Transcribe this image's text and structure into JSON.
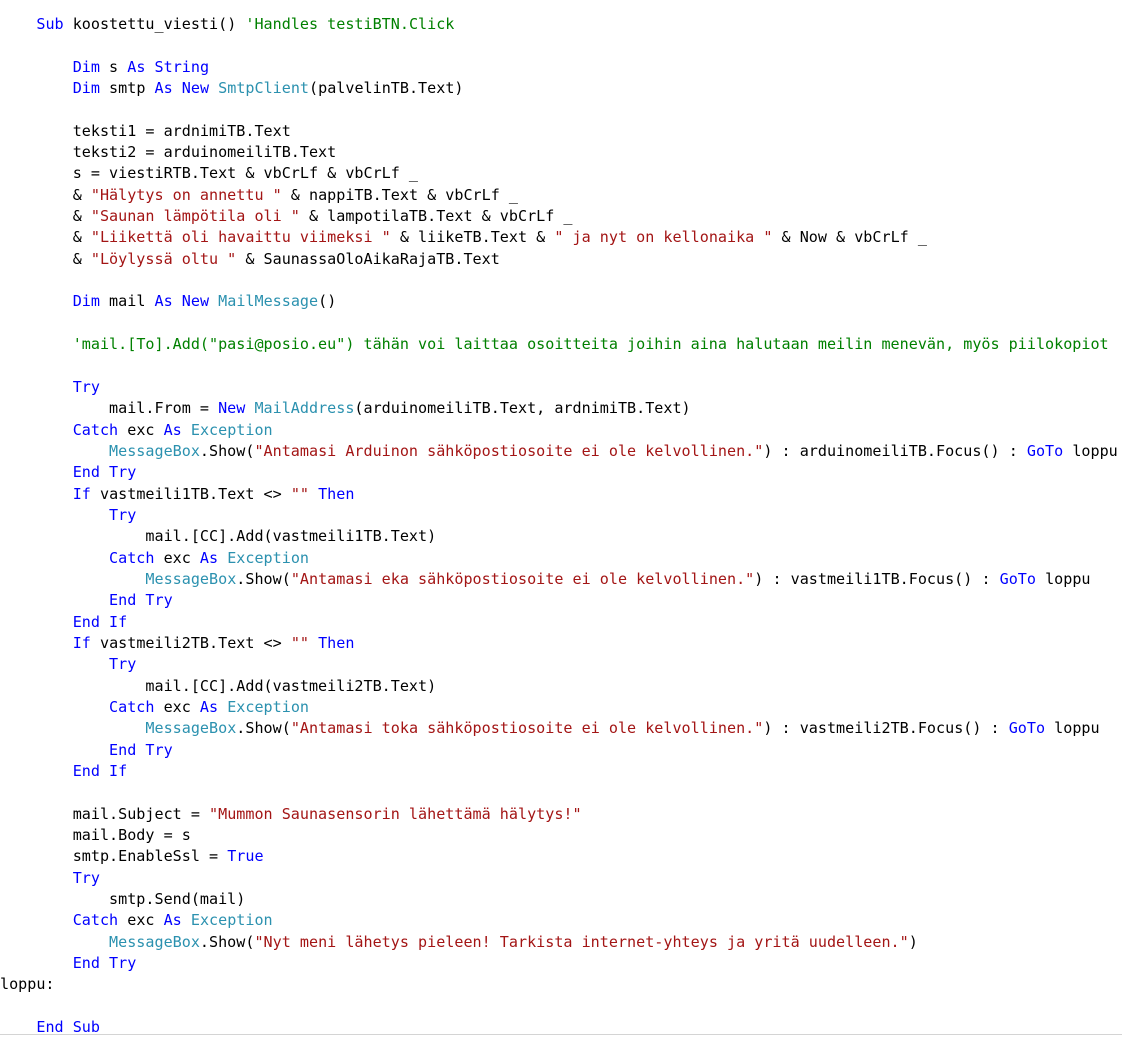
{
  "code": {
    "colors": {
      "keyword": "#0000ff",
      "type": "#2b91af",
      "string": "#a31515",
      "comment": "#008000",
      "plain": "#000000"
    },
    "lines": [
      [
        {
          "t": "    ",
          "c": "pl"
        },
        {
          "t": "Sub",
          "c": "kw"
        },
        {
          "t": " koostettu_viesti() ",
          "c": "pl"
        },
        {
          "t": "'Handles testiBTN.Click",
          "c": "cm"
        }
      ],
      [],
      [
        {
          "t": "        ",
          "c": "pl"
        },
        {
          "t": "Dim",
          "c": "kw"
        },
        {
          "t": " s ",
          "c": "pl"
        },
        {
          "t": "As",
          "c": "kw"
        },
        {
          "t": " ",
          "c": "pl"
        },
        {
          "t": "String",
          "c": "kw"
        }
      ],
      [
        {
          "t": "        ",
          "c": "pl"
        },
        {
          "t": "Dim",
          "c": "kw"
        },
        {
          "t": " smtp ",
          "c": "pl"
        },
        {
          "t": "As",
          "c": "kw"
        },
        {
          "t": " ",
          "c": "pl"
        },
        {
          "t": "New",
          "c": "kw"
        },
        {
          "t": " ",
          "c": "pl"
        },
        {
          "t": "SmtpClient",
          "c": "ty"
        },
        {
          "t": "(palvelinTB.Text)",
          "c": "pl"
        }
      ],
      [],
      [
        {
          "t": "        teksti1 = ardnimiTB.Text",
          "c": "pl"
        }
      ],
      [
        {
          "t": "        teksti2 = arduinomeiliTB.Text",
          "c": "pl"
        }
      ],
      [
        {
          "t": "        s = viestiRTB.Text & vbCrLf & vbCrLf _",
          "c": "pl"
        }
      ],
      [
        {
          "t": "        & ",
          "c": "pl"
        },
        {
          "t": "\"Hälytys on annettu \"",
          "c": "st"
        },
        {
          "t": " & nappiTB.Text & vbCrLf _",
          "c": "pl"
        }
      ],
      [
        {
          "t": "        & ",
          "c": "pl"
        },
        {
          "t": "\"Saunan lämpötila oli \"",
          "c": "st"
        },
        {
          "t": " & lampotilaTB.Text & vbCrLf _",
          "c": "pl"
        }
      ],
      [
        {
          "t": "        & ",
          "c": "pl"
        },
        {
          "t": "\"Liikettä oli havaittu viimeksi \"",
          "c": "st"
        },
        {
          "t": " & liikeTB.Text & ",
          "c": "pl"
        },
        {
          "t": "\" ja nyt on kellonaika \"",
          "c": "st"
        },
        {
          "t": " & Now & vbCrLf _",
          "c": "pl"
        }
      ],
      [
        {
          "t": "        & ",
          "c": "pl"
        },
        {
          "t": "\"Löylyssä oltu \"",
          "c": "st"
        },
        {
          "t": " & SaunassaOloAikaRajaTB.Text",
          "c": "pl"
        }
      ],
      [],
      [
        {
          "t": "        ",
          "c": "pl"
        },
        {
          "t": "Dim",
          "c": "kw"
        },
        {
          "t": " mail ",
          "c": "pl"
        },
        {
          "t": "As",
          "c": "kw"
        },
        {
          "t": " ",
          "c": "pl"
        },
        {
          "t": "New",
          "c": "kw"
        },
        {
          "t": " ",
          "c": "pl"
        },
        {
          "t": "MailMessage",
          "c": "ty"
        },
        {
          "t": "()",
          "c": "pl"
        }
      ],
      [],
      [
        {
          "t": "        ",
          "c": "pl"
        },
        {
          "t": "'mail.[To].Add(\"pasi@posio.eu\") tähän voi laittaa osoitteita joihin aina halutaan meilin menevän, myös piilokopiot",
          "c": "cm"
        }
      ],
      [],
      [
        {
          "t": "        ",
          "c": "pl"
        },
        {
          "t": "Try",
          "c": "kw"
        }
      ],
      [
        {
          "t": "            mail.From = ",
          "c": "pl"
        },
        {
          "t": "New",
          "c": "kw"
        },
        {
          "t": " ",
          "c": "pl"
        },
        {
          "t": "MailAddress",
          "c": "ty"
        },
        {
          "t": "(arduinomeiliTB.Text, ardnimiTB.Text)",
          "c": "pl"
        }
      ],
      [
        {
          "t": "        ",
          "c": "pl"
        },
        {
          "t": "Catch",
          "c": "kw"
        },
        {
          "t": " exc ",
          "c": "pl"
        },
        {
          "t": "As",
          "c": "kw"
        },
        {
          "t": " ",
          "c": "pl"
        },
        {
          "t": "Exception",
          "c": "ty"
        }
      ],
      [
        {
          "t": "            ",
          "c": "pl"
        },
        {
          "t": "MessageBox",
          "c": "ty"
        },
        {
          "t": ".Show(",
          "c": "pl"
        },
        {
          "t": "\"Antamasi Arduinon sähköpostiosoite ei ole kelvollinen.\"",
          "c": "st"
        },
        {
          "t": ") : arduinomeiliTB.Focus() : ",
          "c": "pl"
        },
        {
          "t": "GoTo",
          "c": "kw"
        },
        {
          "t": " loppu",
          "c": "pl"
        }
      ],
      [
        {
          "t": "        ",
          "c": "pl"
        },
        {
          "t": "End Try",
          "c": "kw"
        }
      ],
      [
        {
          "t": "        ",
          "c": "pl"
        },
        {
          "t": "If",
          "c": "kw"
        },
        {
          "t": " vastmeili1TB.Text <> ",
          "c": "pl"
        },
        {
          "t": "\"\"",
          "c": "st"
        },
        {
          "t": " ",
          "c": "pl"
        },
        {
          "t": "Then",
          "c": "kw"
        }
      ],
      [
        {
          "t": "            ",
          "c": "pl"
        },
        {
          "t": "Try",
          "c": "kw"
        }
      ],
      [
        {
          "t": "                mail.[CC].Add(vastmeili1TB.Text)",
          "c": "pl"
        }
      ],
      [
        {
          "t": "            ",
          "c": "pl"
        },
        {
          "t": "Catch",
          "c": "kw"
        },
        {
          "t": " exc ",
          "c": "pl"
        },
        {
          "t": "As",
          "c": "kw"
        },
        {
          "t": " ",
          "c": "pl"
        },
        {
          "t": "Exception",
          "c": "ty"
        }
      ],
      [
        {
          "t": "                ",
          "c": "pl"
        },
        {
          "t": "MessageBox",
          "c": "ty"
        },
        {
          "t": ".Show(",
          "c": "pl"
        },
        {
          "t": "\"Antamasi eka sähköpostiosoite ei ole kelvollinen.\"",
          "c": "st"
        },
        {
          "t": ") : vastmeili1TB.Focus() : ",
          "c": "pl"
        },
        {
          "t": "GoTo",
          "c": "kw"
        },
        {
          "t": " loppu",
          "c": "pl"
        }
      ],
      [
        {
          "t": "            ",
          "c": "pl"
        },
        {
          "t": "End Try",
          "c": "kw"
        }
      ],
      [
        {
          "t": "        ",
          "c": "pl"
        },
        {
          "t": "End If",
          "c": "kw"
        }
      ],
      [
        {
          "t": "        ",
          "c": "pl"
        },
        {
          "t": "If",
          "c": "kw"
        },
        {
          "t": " vastmeili2TB.Text <> ",
          "c": "pl"
        },
        {
          "t": "\"\"",
          "c": "st"
        },
        {
          "t": " ",
          "c": "pl"
        },
        {
          "t": "Then",
          "c": "kw"
        }
      ],
      [
        {
          "t": "            ",
          "c": "pl"
        },
        {
          "t": "Try",
          "c": "kw"
        }
      ],
      [
        {
          "t": "                mail.[CC].Add(vastmeili2TB.Text)",
          "c": "pl"
        }
      ],
      [
        {
          "t": "            ",
          "c": "pl"
        },
        {
          "t": "Catch",
          "c": "kw"
        },
        {
          "t": " exc ",
          "c": "pl"
        },
        {
          "t": "As",
          "c": "kw"
        },
        {
          "t": " ",
          "c": "pl"
        },
        {
          "t": "Exception",
          "c": "ty"
        }
      ],
      [
        {
          "t": "                ",
          "c": "pl"
        },
        {
          "t": "MessageBox",
          "c": "ty"
        },
        {
          "t": ".Show(",
          "c": "pl"
        },
        {
          "t": "\"Antamasi toka sähköpostiosoite ei ole kelvollinen.\"",
          "c": "st"
        },
        {
          "t": ") : vastmeili2TB.Focus() : ",
          "c": "pl"
        },
        {
          "t": "GoTo",
          "c": "kw"
        },
        {
          "t": " loppu",
          "c": "pl"
        }
      ],
      [
        {
          "t": "            ",
          "c": "pl"
        },
        {
          "t": "End Try",
          "c": "kw"
        }
      ],
      [
        {
          "t": "        ",
          "c": "pl"
        },
        {
          "t": "End If",
          "c": "kw"
        }
      ],
      [],
      [
        {
          "t": "        mail.Subject = ",
          "c": "pl"
        },
        {
          "t": "\"Mummon Saunasensorin lähettämä hälytys!\"",
          "c": "st"
        }
      ],
      [
        {
          "t": "        mail.Body = s",
          "c": "pl"
        }
      ],
      [
        {
          "t": "        smtp.EnableSsl = ",
          "c": "pl"
        },
        {
          "t": "True",
          "c": "kw"
        }
      ],
      [
        {
          "t": "        ",
          "c": "pl"
        },
        {
          "t": "Try",
          "c": "kw"
        }
      ],
      [
        {
          "t": "            smtp.Send(mail)",
          "c": "pl"
        }
      ],
      [
        {
          "t": "        ",
          "c": "pl"
        },
        {
          "t": "Catch",
          "c": "kw"
        },
        {
          "t": " exc ",
          "c": "pl"
        },
        {
          "t": "As",
          "c": "kw"
        },
        {
          "t": " ",
          "c": "pl"
        },
        {
          "t": "Exception",
          "c": "ty"
        }
      ],
      [
        {
          "t": "            ",
          "c": "pl"
        },
        {
          "t": "MessageBox",
          "c": "ty"
        },
        {
          "t": ".Show(",
          "c": "pl"
        },
        {
          "t": "\"Nyt meni lähetys pieleen! Tarkista internet-yhteys ja yritä uudelleen.\"",
          "c": "st"
        },
        {
          "t": ")",
          "c": "pl"
        }
      ],
      [
        {
          "t": "        ",
          "c": "pl"
        },
        {
          "t": "End Try",
          "c": "kw"
        }
      ],
      [
        {
          "t": "loppu:",
          "c": "pl"
        }
      ],
      [],
      [
        {
          "t": "    ",
          "c": "pl"
        },
        {
          "t": "End Sub",
          "c": "kw"
        }
      ]
    ]
  }
}
